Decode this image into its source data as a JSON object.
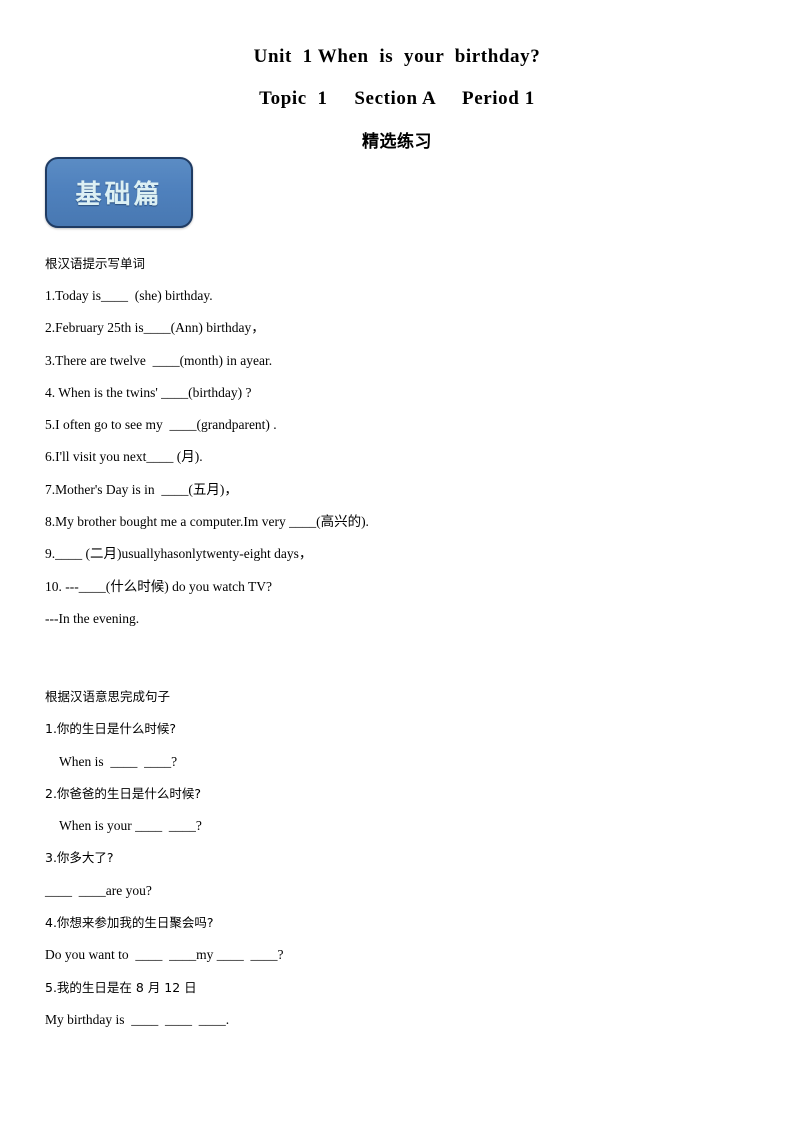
{
  "document": {
    "title_line1": "Unit  1 When  is  your  birthday?",
    "title_line2": "Topic  1     Section A     Period 1",
    "title_cn": "精选练习"
  },
  "badge": {
    "label": "基础篇",
    "fill_color": "#4f81bd",
    "border_color": "#1f3b63",
    "text_color": "#dcf0f4"
  },
  "section1": {
    "heading": "根汉语提示写单词",
    "items": [
      "1.Today is____  (she) birthday.",
      "2.February 25th is____(Ann) birthday，",
      "3.There are twelve  ____(month) in ayear.",
      "4. When is the twins' ____(birthday) ?",
      "5.I often go to see my  ____(grandparent) .",
      "6.I'll visit you next____ (月).",
      "7.Mother's Day is in  ____(五月)，",
      "8.My brother bought me a computer.Im very ____(高兴的).",
      "9.____ (二月)usuallyhasonlytwenty-eight days，",
      "10. ---____(什么时候) do you watch TV?",
      "---In the evening."
    ]
  },
  "section2": {
    "heading": "根据汉语意思完成句子",
    "items": [
      {
        "prompt": "1.你的生日是什么时候?",
        "answer": "When is  ____  ____?",
        "indent": true
      },
      {
        "prompt": "2.你爸爸的生日是什么时候?",
        "answer": "When is your ____  ____?",
        "indent": true
      },
      {
        "prompt": "3.你多大了?",
        "answer": "____  ____are you?",
        "indent": false
      },
      {
        "prompt": "4.你想来参加我的生日聚会吗?",
        "answer": "Do you want to  ____  ____my ____  ____?",
        "indent": false
      },
      {
        "prompt": "5.我的生日是在 8 月 12 日",
        "answer": "My birthday is  ____  ____  ____.",
        "indent": false
      }
    ]
  }
}
